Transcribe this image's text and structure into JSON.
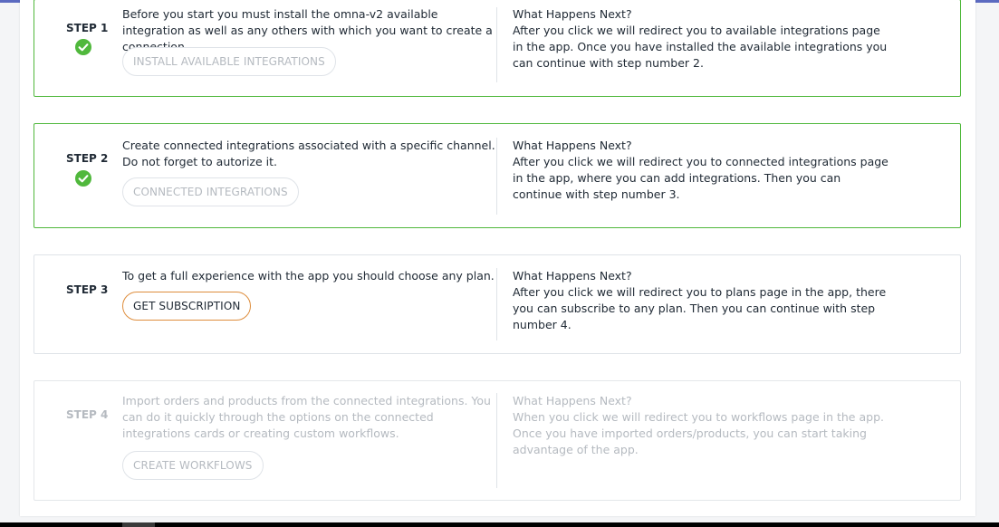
{
  "colors": {
    "done_border": "#50b83c",
    "accent_button_border": "#de8d3c",
    "disabled_text": "#b5bac0"
  },
  "steps": [
    {
      "label": "STEP 1",
      "status": "completed",
      "description": "Before you start you must install the omna-v2 available integration as well as any others with which you want to create a connection.",
      "button": "INSTALL AVAILABLE INTEGRATIONS",
      "next_heading": "What Happens Next?",
      "next_text": "After you click we will redirect you to available integrations page in the app. Once you have installed the available integrations you can continue with step number 2."
    },
    {
      "label": "STEP 2",
      "status": "completed",
      "description": "Create connected integrations associated with a specific channel. Do not forget to autorize it.",
      "button": "CONNECTED INTEGRATIONS",
      "next_heading": "What Happens Next?",
      "next_text": "After you click we will redirect you to connected integrations page in the app, where you can add integrations. Then you can continue with step number 3."
    },
    {
      "label": "STEP 3",
      "status": "current",
      "description": "To get a full experience with the app you should choose any plan.",
      "button": "GET SUBSCRIPTION",
      "next_heading": "What Happens Next?",
      "next_text": "After you click we will redirect you to plans page in the app, there you can subscribe to any plan. Then you can continue with step number 4."
    },
    {
      "label": "STEP 4",
      "status": "disabled",
      "description": "Import orders and products from the connected integrations. You can do it quickly through the options on the connected integrations cards or creating custom workflows.",
      "button": "CREATE WORKFLOWS",
      "next_heading": "What Happens Next?",
      "next_text": "When you click we will redirect you to workflows page in the app. Once you have imported orders/products, you can start taking advantage of the app."
    }
  ]
}
